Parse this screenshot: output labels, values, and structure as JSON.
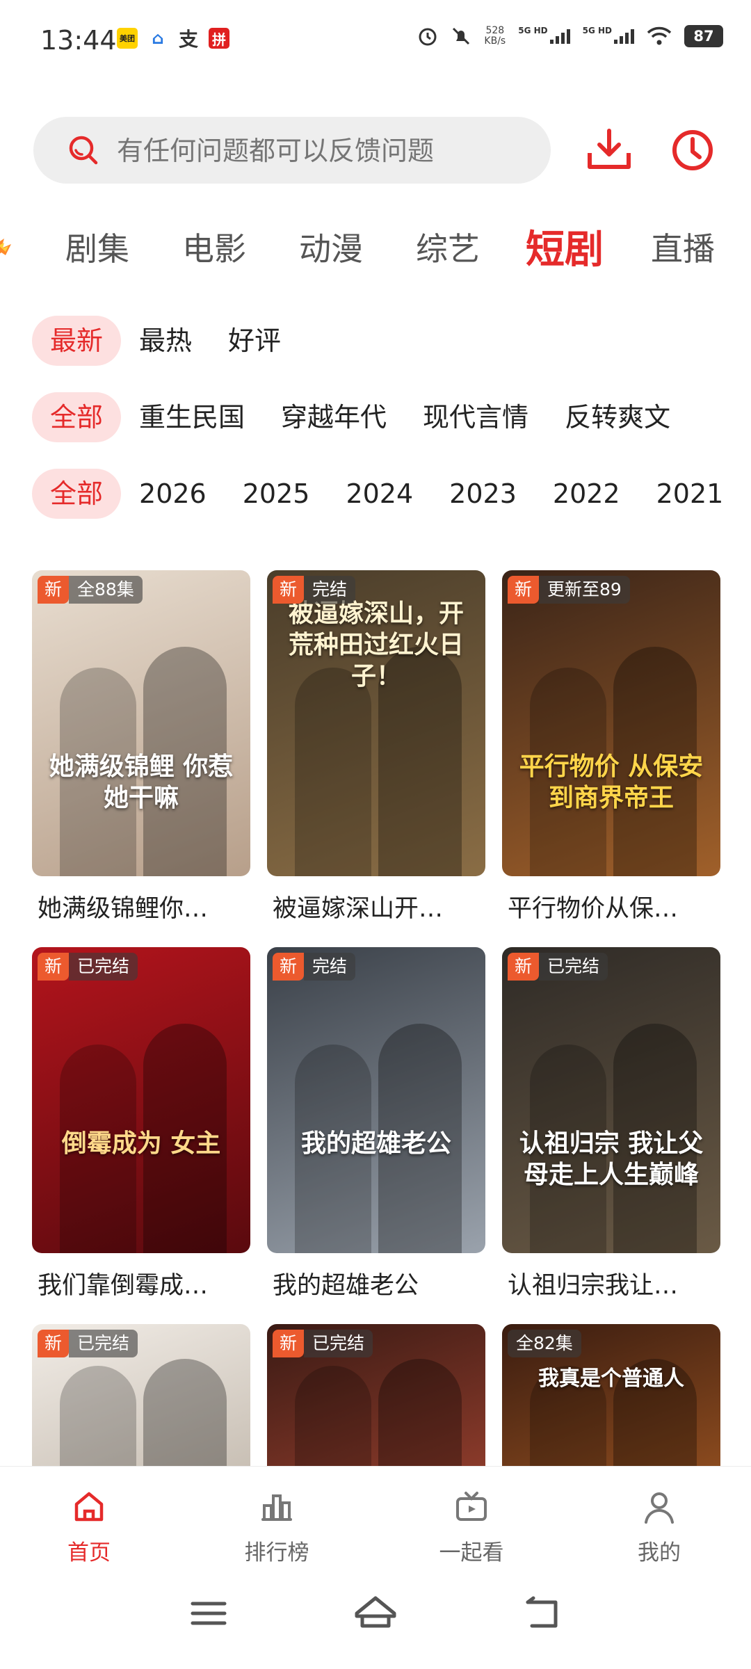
{
  "status_bar": {
    "time": "13:44",
    "apps": [
      {
        "icon": "meituan-icon",
        "label": "美团"
      },
      {
        "icon": "home-app-icon",
        "label": "⌂"
      },
      {
        "icon": "alipay-icon",
        "label": "支"
      },
      {
        "icon": "pinduoduo-icon",
        "label": "拼"
      }
    ],
    "net_speed_value": "528",
    "net_speed_unit": "KB/s",
    "sig1": "5G HD",
    "sig2": "5G HD",
    "battery": "87"
  },
  "search": {
    "placeholder": "有任何问题都可以反馈问题"
  },
  "categories": [
    {
      "label": "剧集",
      "active": false
    },
    {
      "label": "电影",
      "active": false
    },
    {
      "label": "动漫",
      "active": false
    },
    {
      "label": "综艺",
      "active": false
    },
    {
      "label": "短剧",
      "active": true
    },
    {
      "label": "直播",
      "active": false
    }
  ],
  "filters": {
    "sort": [
      "最新",
      "最热",
      "好评"
    ],
    "genre": [
      "全部",
      "重生民国",
      "穿越年代",
      "现代言情",
      "反转爽文"
    ],
    "year": [
      "全部",
      "2026",
      "2025",
      "2024",
      "2023",
      "2022",
      "2021"
    ]
  },
  "items": [
    {
      "title": "她满级锦鲤你…",
      "new": "新",
      "status": "全88集",
      "poster_text": "她满级锦鲤 你惹她干嘛",
      "bg1": "#e8ddd0",
      "bg2": "#b79f8a",
      "text_color": "#ffffff"
    },
    {
      "title": "被逼嫁深山开…",
      "new": "新",
      "status": "完结",
      "poster_text": "被逼嫁深山，开荒种田过红火日子！",
      "bg1": "#4a3d2a",
      "bg2": "#8a6d45",
      "text_color": "#fff3d0"
    },
    {
      "title": "平行物价从保…",
      "new": "新",
      "status": "更新至89",
      "poster_text": "平行物价 从保安到商界帝王",
      "bg1": "#3a2418",
      "bg2": "#a0602a",
      "text_color": "#ffd54a"
    },
    {
      "title": "我们靠倒霉成…",
      "new": "新",
      "status": "已完结",
      "poster_text": "倒霉成为 女主",
      "bg1": "#b3141c",
      "bg2": "#5a0a0e",
      "text_color": "#ffd98a"
    },
    {
      "title": "我的超雄老公",
      "new": "新",
      "status": "完结",
      "poster_text": "我的超雄老公",
      "bg1": "#3a4048",
      "bg2": "#9aa2ac",
      "text_color": "#ffffff"
    },
    {
      "title": "认祖归宗我让…",
      "new": "新",
      "status": "已完结",
      "poster_text": "认祖归宗 我让父母走上人生巅峰",
      "bg1": "#2e2a26",
      "bg2": "#6a5a45",
      "text_color": "#ffffff"
    },
    {
      "title": "",
      "new": "新",
      "status": "已完结",
      "poster_text": "",
      "bg1": "#f1ece6",
      "bg2": "#c9c0b5",
      "text_color": "#333333"
    },
    {
      "title": "",
      "new": "新",
      "status": "已完结",
      "poster_text": "",
      "bg1": "#3a1a14",
      "bg2": "#8a3a2a",
      "text_color": "#ffffff"
    },
    {
      "title": "",
      "new": "",
      "status": "全82集",
      "poster_text": "我真是个普通人",
      "bg1": "#3a1c10",
      "bg2": "#8a4a1e",
      "text_color": "#ffffff"
    }
  ],
  "bottom_nav": [
    {
      "label": "首页",
      "icon": "home-icon",
      "active": true
    },
    {
      "label": "排行榜",
      "icon": "ranking-icon",
      "active": false
    },
    {
      "label": "一起看",
      "icon": "tv-icon",
      "active": false
    },
    {
      "label": "我的",
      "icon": "profile-icon",
      "active": false
    }
  ],
  "colors": {
    "accent": "#e52a2a",
    "chip_bg": "#fde0e0",
    "badge_new": "#ec5a2e"
  }
}
